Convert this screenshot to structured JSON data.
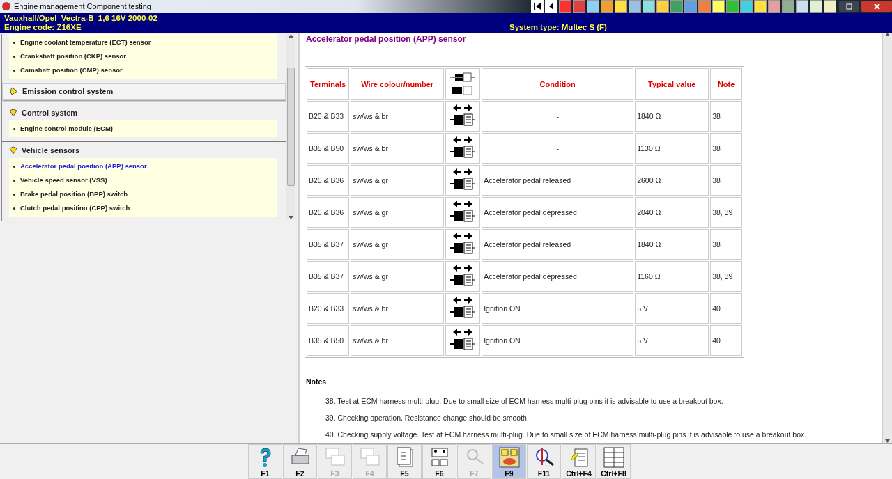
{
  "window": {
    "title": "Engine management Component testing"
  },
  "header": {
    "vehicle": "Vauxhall/Opel  Vectra-B  1,6 16V 2000-02",
    "engine_code": "Engine code: Z16XE",
    "system_type": "System type: Multec S (F)"
  },
  "sidebar": {
    "sections": [
      {
        "items": [
          {
            "label": "Engine coolant temperature (ECT) sensor",
            "selected": false
          },
          {
            "label": "Crankshaft position (CKP) sensor",
            "selected": false
          },
          {
            "label": "Camshaft position (CMP) sensor",
            "selected": false
          }
        ]
      },
      {
        "title": "Emission control system",
        "expanded": false
      },
      {
        "title": "Control system",
        "expanded": true,
        "items": [
          {
            "label": "Engine control module (ECM)",
            "selected": false
          }
        ]
      },
      {
        "title": "Vehicle sensors",
        "expanded": true,
        "items": [
          {
            "label": "Accelerator pedal position (APP) sensor",
            "selected": true
          },
          {
            "label": "Vehicle speed sensor (VSS)",
            "selected": false
          },
          {
            "label": "Brake pedal position (BPP) switch",
            "selected": false
          },
          {
            "label": "Clutch pedal position (CPP) switch",
            "selected": false
          }
        ]
      }
    ]
  },
  "content": {
    "title": "Accelerator pedal position (APP) sensor",
    "table": {
      "columns": [
        "Terminals",
        "Wire colour/number",
        "Condition",
        "Typical value",
        "Note"
      ],
      "rows": [
        {
          "terminals": "B20 & B33",
          "wire": "sw/ws & br",
          "condition": "-",
          "value": "1840 Ω",
          "note": "38"
        },
        {
          "terminals": "B35 & B50",
          "wire": "sw/ws & br",
          "condition": "-",
          "value": "1130 Ω",
          "note": "38"
        },
        {
          "terminals": "B20 & B36",
          "wire": "sw/ws & gr",
          "condition": "Accelerator pedal released",
          "value": "2600 Ω",
          "note": "38"
        },
        {
          "terminals": "B20 & B36",
          "wire": "sw/ws & gr",
          "condition": "Accelerator pedal depressed",
          "value": "2040 Ω",
          "note": "38, 39"
        },
        {
          "terminals": "B35 & B37",
          "wire": "sw/ws & gr",
          "condition": "Accelerator pedal released",
          "value": "1840 Ω",
          "note": "38"
        },
        {
          "terminals": "B35 & B37",
          "wire": "sw/ws & gr",
          "condition": "Accelerator pedal depressed",
          "value": "1160 Ω",
          "note": "38, 39"
        },
        {
          "terminals": "B20 & B33",
          "wire": "sw/ws & br",
          "condition": "Ignition ON",
          "value": "5 V",
          "note": "40"
        },
        {
          "terminals": "B35 & B50",
          "wire": "sw/ws & br",
          "condition": "Ignition ON",
          "value": "5 V",
          "note": "40"
        }
      ]
    },
    "notes_title": "Notes",
    "notes": [
      "38. Test at ECM harness multi-plug. Due to small size of ECM harness multi-plug pins it is advisable to use a breakout box.",
      "39. Checking operation. Resistance change should be smooth.",
      "40. Checking supply voltage. Test at ECM harness multi-plug. Due to small size of ECM harness multi-plug pins it is advisable to use a breakout box."
    ]
  },
  "function_keys": [
    {
      "label": "F1",
      "disabled": false,
      "selected": false
    },
    {
      "label": "F2",
      "disabled": false,
      "selected": false
    },
    {
      "label": "F3",
      "disabled": true,
      "selected": false
    },
    {
      "label": "F4",
      "disabled": true,
      "selected": false
    },
    {
      "label": "F5",
      "disabled": false,
      "selected": false
    },
    {
      "label": "F6",
      "disabled": false,
      "selected": false
    },
    {
      "label": "F7",
      "disabled": true,
      "selected": false
    },
    {
      "label": "F9",
      "disabled": false,
      "selected": true
    },
    {
      "label": "F11",
      "disabled": false,
      "selected": false
    },
    {
      "label": "Ctrl+F4",
      "disabled": false,
      "selected": false
    },
    {
      "label": "Ctrl+F8",
      "disabled": false,
      "selected": false
    }
  ]
}
